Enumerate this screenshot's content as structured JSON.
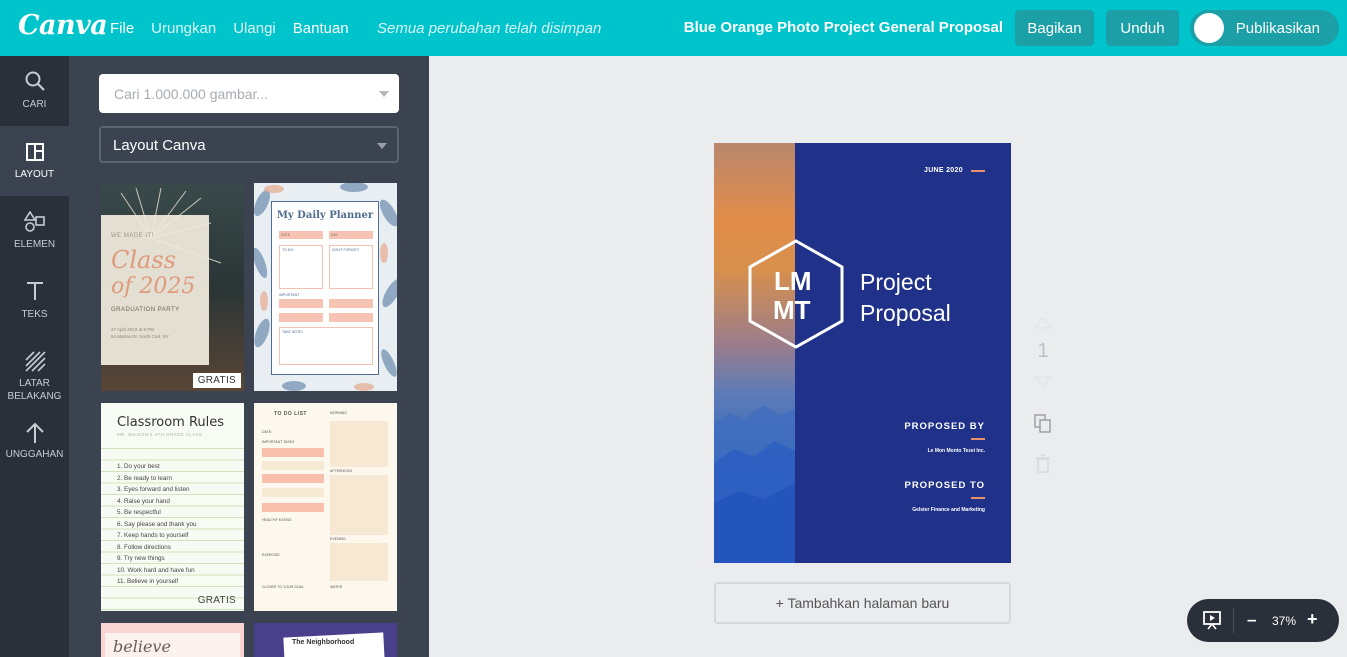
{
  "header": {
    "logo": "Canva",
    "menu": [
      {
        "label": "File",
        "dim": false
      },
      {
        "label": "Urungkan",
        "dim": true
      },
      {
        "label": "Ulangi",
        "dim": true
      },
      {
        "label": "Bantuan",
        "dim": false
      }
    ],
    "save_status": "Semua perubahan telah disimpan",
    "document_title": "Blue Orange Photo Project General Proposal",
    "share_label": "Bagikan",
    "download_label": "Unduh",
    "publish_label": "Publikasikan"
  },
  "rail": {
    "items": [
      {
        "label": "CARI",
        "icon": "search-icon",
        "active": false
      },
      {
        "label": "LAYOUT",
        "icon": "layout-icon",
        "active": true
      },
      {
        "label": "ELEMEN",
        "icon": "shapes-icon",
        "active": false
      },
      {
        "label": "TEKS",
        "icon": "text-icon",
        "active": false
      },
      {
        "label": "LATAR BELAKANG",
        "icon": "background-icon",
        "active": false
      },
      {
        "label": "UNGGAHAN",
        "icon": "upload-icon",
        "active": false
      }
    ]
  },
  "panel": {
    "search_placeholder": "Cari 1.000.000 gambar...",
    "layout_select": "Layout Canva",
    "templates": {
      "t1": {
        "line1": "WE MADE IT!",
        "line2": "Class",
        "line3": "of 2025",
        "line4": "GRADUATION PARTY",
        "line5": "27 April 2023 at 5 PM",
        "line6": "64 Marina Dr. North Civil, NY",
        "badge": "GRATIS"
      },
      "t2": {
        "title": "My Daily Planner",
        "date": "DATE",
        "day": "DAY",
        "todo": "TO DO:",
        "dontforget": "DON'T FORGET!",
        "important": "IMPORTANT",
        "takenote": "TAKE NOTE!"
      },
      "t3": {
        "title": "Classroom Rules",
        "subtitle": "MR. WILSON'S 4TH GRADE CLASS",
        "rules": [
          "1. Do your best",
          "2. Be ready to learn",
          "3. Eyes forward and listen",
          "4. Raise your hand",
          "5. Be respectful",
          "6. Say please and thank you",
          "7. Keep hands to yourself",
          "8. Follow directions",
          "9. Try new things",
          "10. Work hard and have fun",
          "11. Believe in yourself"
        ],
        "badge": "GRATIS"
      },
      "t4": {
        "title": "TO DO LIST",
        "date": "DATE:",
        "important": "IMPORTANT TASKS",
        "morning": "MORNING",
        "afternoon": "AFTERNOON",
        "healthy": "HEALTHY EATING",
        "evening": "EVENING",
        "exercise": "EXERCISE",
        "closer": "CLOSER TO YOUR GOAL",
        "water": "WATER"
      },
      "t5": {
        "text": "believe"
      },
      "t6": {
        "text": "The Neighborhood"
      }
    }
  },
  "page": {
    "date": "JUNE 2020",
    "monogram_line1": "LM",
    "monogram_line2": "MT",
    "title_line1": "Project",
    "title_line2": "Proposal",
    "proposed_by_label": "PROPOSED BY",
    "proposed_by_value": "Le Mon Monto Tezei Inc.",
    "proposed_to_label": "PROPOSED TO",
    "proposed_to_value": "Gelster Finance and Marketing",
    "accent_color": "#e8916a",
    "background_color": "#1f3188"
  },
  "page_tools": {
    "page_number": "1"
  },
  "add_page_label": "+ Tambahkan halaman baru",
  "zoom": {
    "level": "37%",
    "minus": "–",
    "plus": "+"
  },
  "colors": {
    "topbar": "#00c4cc",
    "rail": "#293039",
    "panel": "#3c4350",
    "workspace": "#ebecee"
  }
}
